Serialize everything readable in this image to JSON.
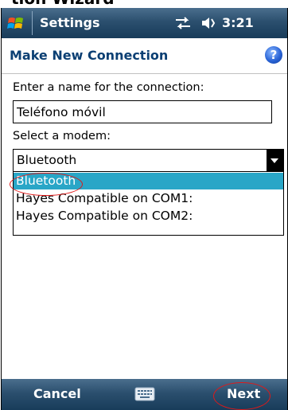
{
  "top_cropped_text": "tion Wizard",
  "titlebar": {
    "title": "Settings",
    "time": "3:21",
    "icons": [
      "windows-start-icon",
      "connectivity-icon",
      "volume-icon"
    ]
  },
  "header": {
    "title": "Make New Connection",
    "help_icon": "?"
  },
  "form": {
    "name_label": "Enter a name for the connection:",
    "name_value": "Teléfono móvil",
    "modem_label": "Select a modem:",
    "modem_selected": "Bluetooth",
    "modem_options": [
      {
        "label": "Bluetooth",
        "highlighted": true
      },
      {
        "label": "Hayes Compatible on COM1:",
        "highlighted": false
      },
      {
        "label": "Hayes Compatible on COM2:",
        "highlighted": false
      }
    ]
  },
  "softkeys": {
    "left": "Cancel",
    "right": "Next",
    "center_icon": "keyboard-icon"
  },
  "colors": {
    "bar": "#2b4f6e",
    "header_text": "#0b3f73",
    "highlight": "#29a6c7",
    "annotation": "#e01818"
  }
}
